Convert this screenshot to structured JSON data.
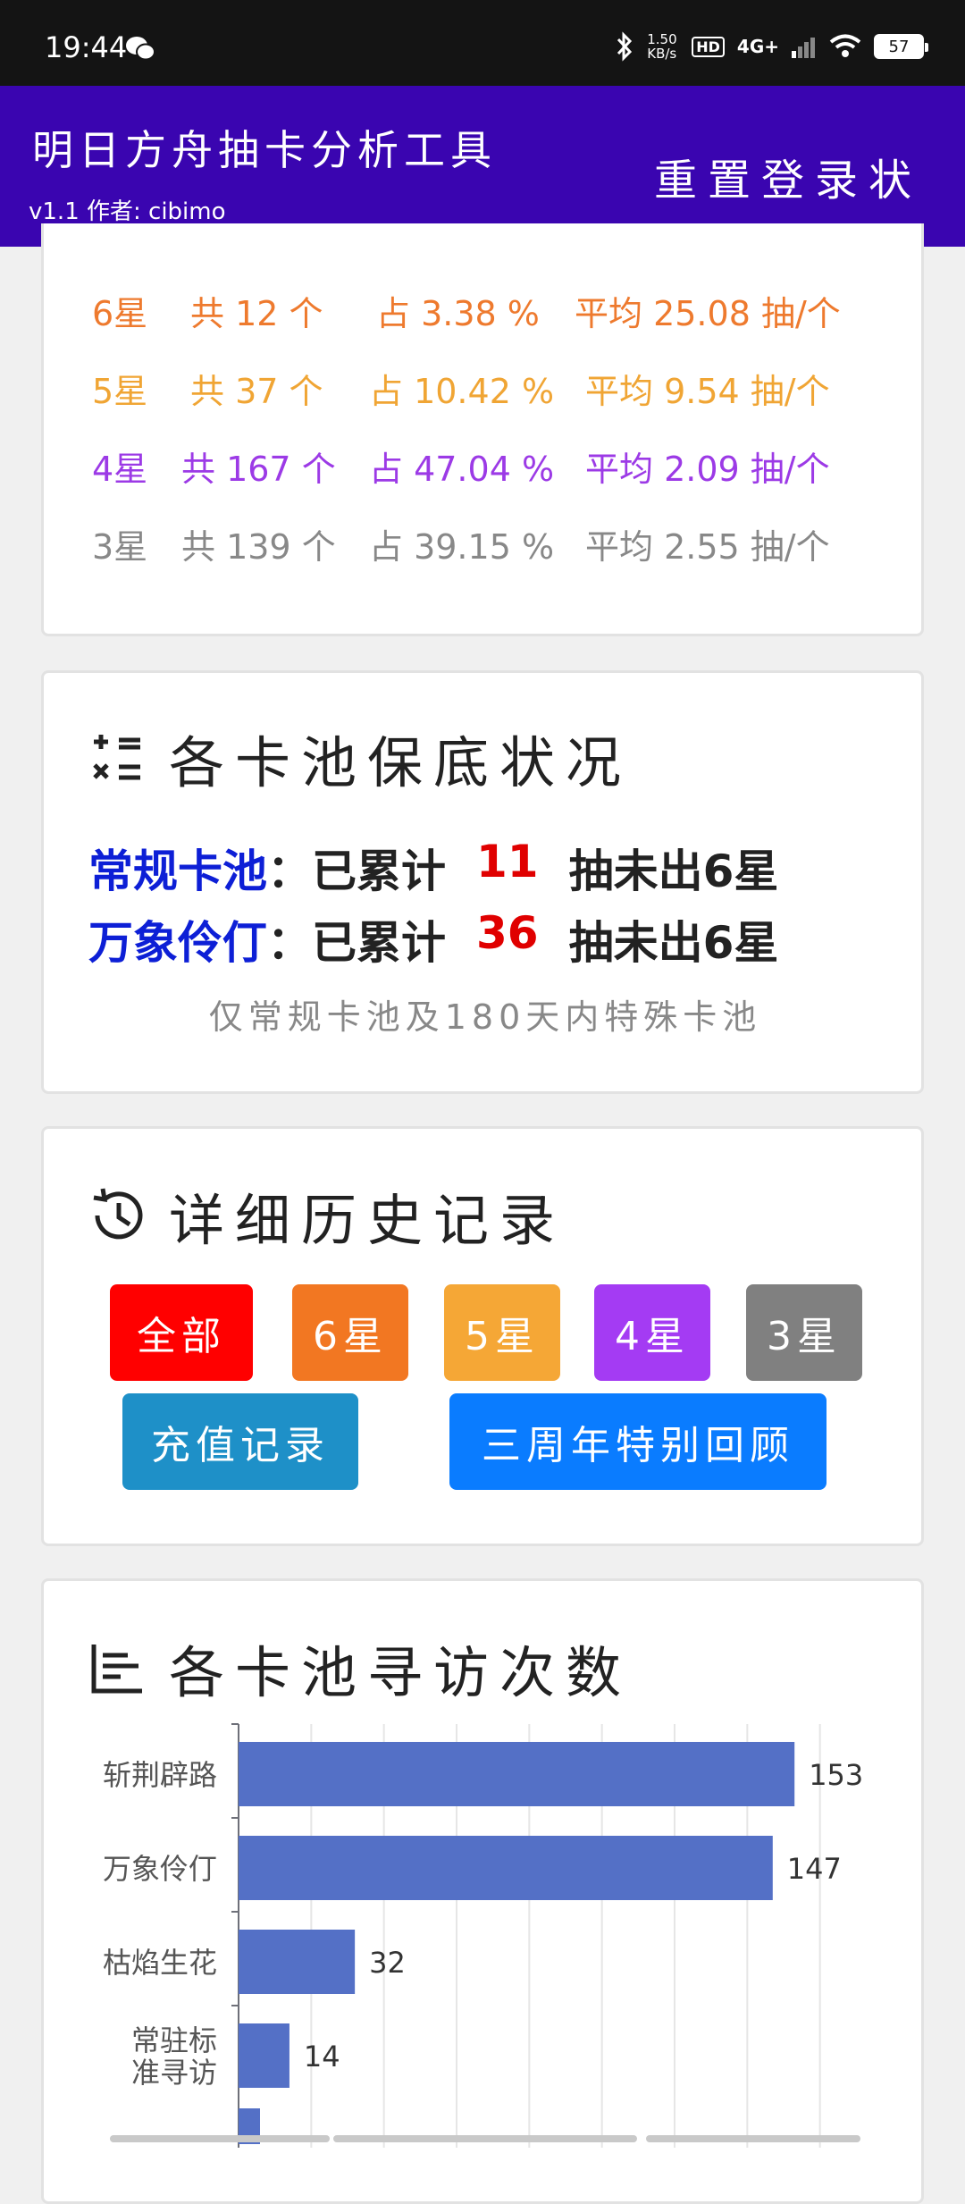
{
  "status_bar": {
    "time": "19:44",
    "net_speed": "1.50 KB/s",
    "hd": "HD",
    "network": "4G+",
    "battery": "57"
  },
  "app_bar": {
    "title": "明日方舟抽卡分析工具",
    "subtitle": "v1.1 作者: cibimo",
    "reset_label": "重置登录状"
  },
  "stats": [
    {
      "star": "6星",
      "count": "共 12 个",
      "pct": "占 3.38 %",
      "avg": "平均 25.08 抽/个",
      "color": "#ee7a2e"
    },
    {
      "star": "5星",
      "count": "共 37 个",
      "pct": "占 10.42 %",
      "avg": "平均 9.54 抽/个",
      "color": "#f0a534"
    },
    {
      "star": "4星",
      "count": "共 167 个",
      "pct": "占 47.04 %",
      "avg": "平均 2.09 抽/个",
      "color": "#9c3ae6"
    },
    {
      "star": "3星",
      "count": "共 139 个",
      "pct": "占 39.15 %",
      "avg": "平均 2.55 抽/个",
      "color": "#888888"
    }
  ],
  "pity": {
    "title": "各卡池保底状况",
    "lines": [
      {
        "pool": "常规卡池",
        "prefix": "：已累计",
        "count": "11",
        "suffix": "抽未出6星"
      },
      {
        "pool": "万象伶仃",
        "prefix": "：已累计",
        "count": "36",
        "suffix": "抽未出6星"
      }
    ],
    "note": "仅常规卡池及180天内特殊卡池"
  },
  "history": {
    "title": "详细历史记录",
    "buttons": [
      {
        "label": "全部",
        "color": "#ff0000"
      },
      {
        "label": "6星",
        "color": "#f27722"
      },
      {
        "label": "5星",
        "color": "#f5a736"
      },
      {
        "label": "4星",
        "color": "#a43bf3"
      },
      {
        "label": "3星",
        "color": "#808080"
      },
      {
        "label": "充值记录",
        "color": "#1e90c8"
      },
      {
        "label": "三周年特别回顾",
        "color": "#0a7cff"
      }
    ]
  },
  "visits": {
    "title": "各卡池寻访次数"
  },
  "chart_data": {
    "type": "bar",
    "orientation": "horizontal",
    "categories": [
      "斩荆辟路",
      "万象伶仃",
      "枯焰生花",
      "常驻标准寻访"
    ],
    "category_lines": [
      [
        "斩荆辟路"
      ],
      [
        "万象伶仃"
      ],
      [
        "枯焰生花"
      ],
      [
        "常驻标",
        "准寻访"
      ]
    ],
    "values": [
      153,
      147,
      32,
      14
    ],
    "value_labels": [
      "153",
      "147",
      "32",
      "14"
    ],
    "xlim": [
      0,
      180
    ],
    "grid": true,
    "bar_color": "#5470c6"
  }
}
